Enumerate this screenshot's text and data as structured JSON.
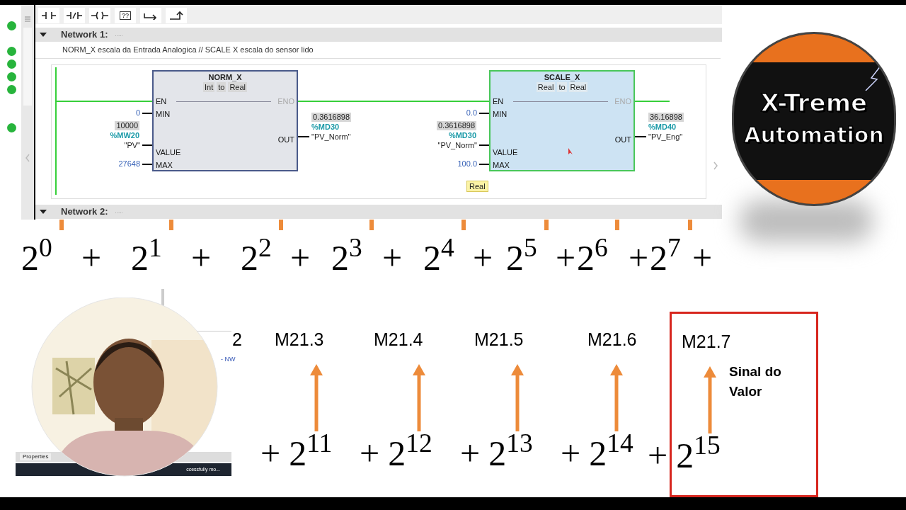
{
  "editor": {
    "toolbar": [
      {
        "kind": "contact"
      },
      {
        "kind": "negated"
      },
      {
        "kind": "coil"
      },
      {
        "kind": "box",
        "label": "??"
      },
      {
        "kind": "open_branch"
      },
      {
        "kind": "close_branch"
      }
    ],
    "status_dots": [
      {
        "ok": true
      },
      {
        "ok": true
      },
      {
        "ok": true
      },
      {
        "ok": true
      },
      {
        "ok": true
      },
      {
        "ok": true
      }
    ],
    "networks": [
      {
        "title": "Network 1:",
        "dots": ".....",
        "expanded": true,
        "comment": "NORM_X escala da Entrada Analogica // SCALE X escala do sensor lido",
        "blocks": [
          {
            "name": "NORM_X",
            "types": [
              "Int",
              "to",
              "Real"
            ],
            "selected": false,
            "eno": "ENO",
            "inputs": [
              {
                "pin": "EN",
                "kind": "enable"
              },
              {
                "pin": "MIN",
                "kind": "constant",
                "value": "0"
              },
              {
                "pin": "VALUE",
                "kind": "tag",
                "value": "10000",
                "address": "%MW20",
                "tag": "\"PV\""
              },
              {
                "pin": "MAX",
                "kind": "constant",
                "value": "27648"
              }
            ],
            "output": {
              "pin": "OUT",
              "value": "0.3616898",
              "address": "%MD30",
              "tag": "\"PV_Norm\""
            }
          },
          {
            "name": "SCALE_X",
            "types": [
              "Real",
              "to",
              "Real"
            ],
            "selected": true,
            "eno": "ENO",
            "inputs": [
              {
                "pin": "EN",
                "kind": "enable"
              },
              {
                "pin": "MIN",
                "kind": "constant",
                "value": "0.0"
              },
              {
                "pin": "VALUE",
                "kind": "tag",
                "value": "0.3616898",
                "address": "%MD30",
                "tag": "\"PV_Norm\""
              },
              {
                "pin": "MAX",
                "kind": "constant",
                "value": "100.0"
              }
            ],
            "output": {
              "pin": "OUT",
              "value": "36.16898",
              "address": "%MD40",
              "tag": "\"PV_Eng\""
            },
            "type_hint": "Real"
          }
        ]
      },
      {
        "title": "Network 2:",
        "dots": ".....",
        "expanded": true
      }
    ]
  },
  "logo": {
    "lines": [
      "X-Treme",
      "Automation"
    ]
  },
  "top_row": [
    "2$^{0}$",
    "+",
    "2$^{1}$",
    "+",
    "2$^{2}$",
    "+",
    "2$^{3}$",
    "+",
    "2$^{4}$",
    "+",
    "2$^{5}$",
    "+",
    "2$^{6}$",
    "+",
    "2$^{7}$",
    "+"
  ],
  "bits": [
    {
      "label": "2",
      "arrow": false
    },
    {
      "label": "M21.3",
      "arrow": true,
      "term": "2$^{11}$"
    },
    {
      "label": "M21.4",
      "arrow": true,
      "term": "2$^{12}$"
    },
    {
      "label": "M21.5",
      "arrow": true,
      "term": "2$^{13}$"
    },
    {
      "label": "M21.6",
      "arrow": true,
      "term": "2$^{14}$"
    },
    {
      "label": "M21.7",
      "arrow": true,
      "term": "2$^{15}$",
      "highlighted": true,
      "note": "Sinal do Valor"
    }
  ],
  "plus": "+",
  "background_window": {
    "tab": "Properties",
    "status": "ccessfully mo...",
    "link": "- NW"
  }
}
